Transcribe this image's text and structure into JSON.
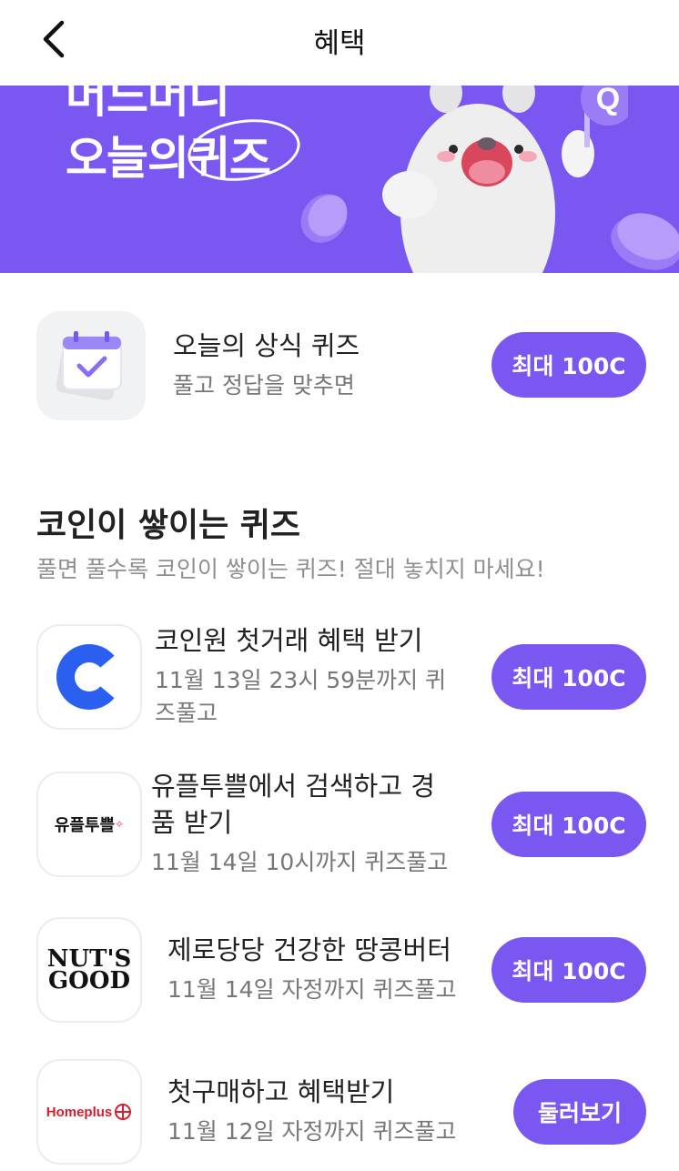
{
  "header": {
    "title": "혜택",
    "back_icon": "chevron-left-icon"
  },
  "banner": {
    "line1": "머느머니",
    "line2_prefix": "오늘의",
    "line2_highlight": "퀴즈",
    "bg_color": "#7b57f2",
    "mascot_letter": "Q"
  },
  "daily_quiz": {
    "title": "오늘의 상식 퀴즈",
    "subtitle": "풀고 정답을 맞추면",
    "button": "최대 100C",
    "icon": "calendar-check-icon"
  },
  "section": {
    "title": "코인이 쌓이는 퀴즈",
    "subtitle": "풀면 풀수록 코인이 쌓이는 퀴즈! 절대 놓치지 마세요!"
  },
  "quizzes": [
    {
      "title": "코인원 첫거래 혜택 받기",
      "subtitle_line1": "11월 13일 23시 59분까지 퀴",
      "subtitle_line2": "즈풀고",
      "button": "최대 100C",
      "logo": "coinone-logo"
    },
    {
      "title_line1": "유플투쁠에서 검색하고 경",
      "title_line2": "품 받기",
      "subtitle": "11월 14일 10시까지 퀴즈풀고",
      "button": "최대 100C",
      "logo_text": "유플투쁠"
    },
    {
      "title": "제로당당 건강한 땅콩버터",
      "subtitle": "11월 14일 자정까지 퀴즈풀고",
      "button": "최대 100C",
      "logo_line1": "NUT'S",
      "logo_line2": "GOOD"
    },
    {
      "title": "첫구매하고 혜택받기",
      "subtitle": "11월 12일 자정까지 퀴즈풀고",
      "button": "둘러보기",
      "logo_text": "Homeplus"
    }
  ],
  "accent_color": "#7b57f2"
}
